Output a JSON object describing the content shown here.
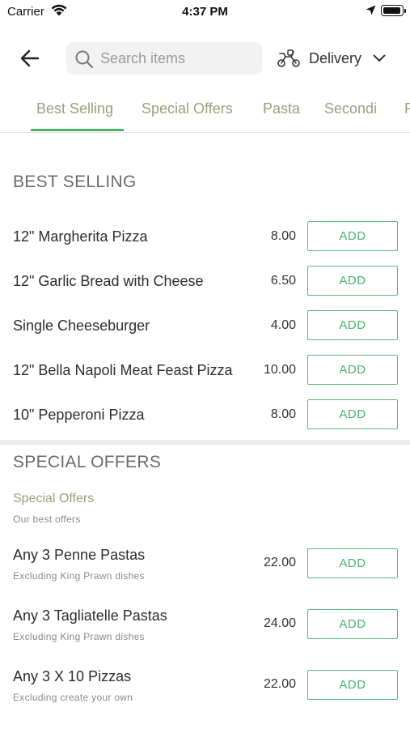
{
  "status_bar": {
    "carrier": "Carrier",
    "time": "4:37 PM"
  },
  "header": {
    "search_placeholder": "Search items",
    "delivery_label": "Delivery"
  },
  "tabs": [
    {
      "label": "Best Selling",
      "active": true
    },
    {
      "label": "Special Offers",
      "active": false
    },
    {
      "label": "Pasta",
      "active": false
    },
    {
      "label": "Secondi",
      "active": false
    },
    {
      "label": "P",
      "active": false
    }
  ],
  "best_selling": {
    "title": "BEST SELLING",
    "items": [
      {
        "name": "12\" Margherita Pizza",
        "price": "8.00",
        "button": "ADD"
      },
      {
        "name": "12\" Garlic Bread with Cheese",
        "price": "6.50",
        "button": "ADD"
      },
      {
        "name": "Single Cheeseburger",
        "price": "4.00",
        "button": "ADD"
      },
      {
        "name": "12\" Bella Napoli Meat Feast Pizza",
        "price": "10.00",
        "button": "ADD"
      },
      {
        "name": "10\" Pepperoni Pizza",
        "price": "8.00",
        "button": "ADD"
      }
    ]
  },
  "special_offers": {
    "title": "SPECIAL OFFERS",
    "group_title": "Special Offers",
    "group_subtitle": "Our best offers",
    "items": [
      {
        "name": "Any 3 Penne Pastas",
        "note": "Excluding King Prawn dishes",
        "price": "22.00",
        "button": "ADD"
      },
      {
        "name": "Any 3 Tagliatelle Pastas",
        "note": "Excluding King Prawn dishes",
        "price": "24.00",
        "button": "ADD"
      },
      {
        "name": "Any 3 X 10 Pizzas",
        "note": "Excluding create your own",
        "price": "22.00",
        "button": "ADD"
      }
    ]
  },
  "colors": {
    "accent": "#4ab36a",
    "tab_text": "#a29d7c"
  },
  "icons": [
    "wifi-icon",
    "location-arrow-icon",
    "battery-icon",
    "back-arrow-icon",
    "search-icon",
    "scooter-icon",
    "chevron-down-icon"
  ]
}
